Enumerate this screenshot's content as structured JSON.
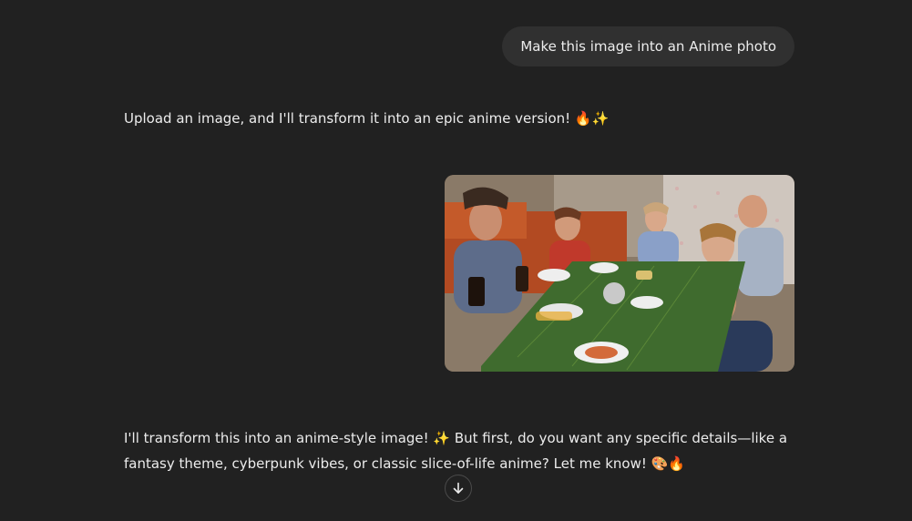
{
  "conversation": {
    "user_message": "Make this image into an Anime photo",
    "assistant_message_1": "Upload an image, and I'll transform it into an epic anime version! 🔥✨",
    "assistant_message_2": "I'll transform this into an anime-style image! ✨ But first, do you want any specific details—like a fantasy theme, cyberpunk vibes, or classic slice-of-life anime? Let me know! 🎨🔥"
  },
  "controls": {
    "scroll_down_icon": "arrow-down-icon"
  },
  "colors": {
    "background": "#212121",
    "user_bubble": "#303030",
    "text": "#ececec"
  }
}
